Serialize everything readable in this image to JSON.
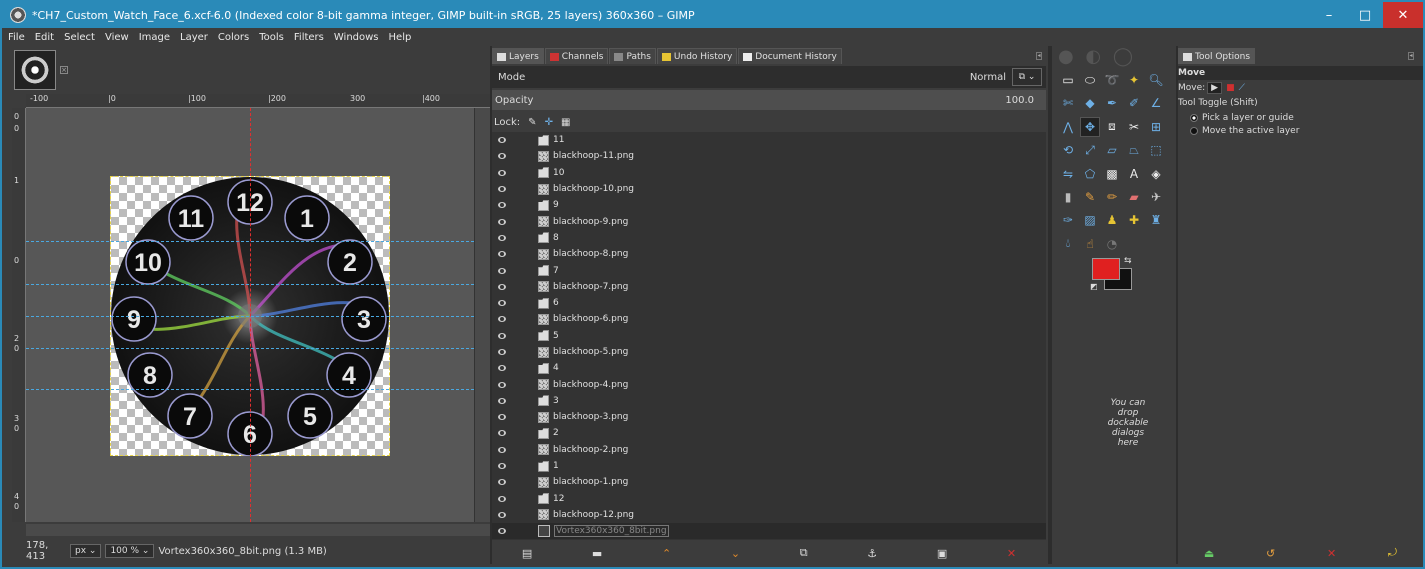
{
  "window": {
    "title": "*CH7_Custom_Watch_Face_6.xcf-6.0 (Indexed color 8-bit gamma integer, GIMP built-in sRGB, 25 layers) 360x360 – GIMP",
    "controls": {
      "minimize": "–",
      "maximize": "□",
      "close": "✕"
    }
  },
  "menu": [
    "File",
    "Edit",
    "Select",
    "View",
    "Image",
    "Layer",
    "Colors",
    "Tools",
    "Filters",
    "Windows",
    "Help"
  ],
  "rulers": {
    "top": [
      "-100",
      "|0",
      "|100",
      "|200",
      "300",
      "|400"
    ],
    "left": [
      "0",
      "0",
      "1",
      "0",
      "2",
      "0",
      "3",
      "0",
      "4",
      "0"
    ]
  },
  "canvas": {
    "dial_numbers": [
      "12",
      "1",
      "2",
      "3",
      "4",
      "5",
      "6",
      "7",
      "8",
      "9",
      "10",
      "11"
    ]
  },
  "status": {
    "coords": "178, 413",
    "unit": "px",
    "zoom": "100 %",
    "info": "Vortex360x360_8bit.png (1.3 MB)"
  },
  "dock_tabs": [
    "Layers",
    "Channels",
    "Paths",
    "Undo History",
    "Document History"
  ],
  "layers_panel": {
    "mode_label": "Mode",
    "mode_value": "Normal",
    "opacity_label": "Opacity",
    "opacity_value": "100.0",
    "lock_label": "Lock:",
    "layers": [
      {
        "name": "11",
        "type": "folder"
      },
      {
        "name": "blackhoop-11.png",
        "type": "png"
      },
      {
        "name": "10",
        "type": "folder"
      },
      {
        "name": "blackhoop-10.png",
        "type": "png"
      },
      {
        "name": "9",
        "type": "folder"
      },
      {
        "name": "blackhoop-9.png",
        "type": "png"
      },
      {
        "name": "8",
        "type": "folder"
      },
      {
        "name": "blackhoop-8.png",
        "type": "png"
      },
      {
        "name": "7",
        "type": "folder"
      },
      {
        "name": "blackhoop-7.png",
        "type": "png"
      },
      {
        "name": "6",
        "type": "folder"
      },
      {
        "name": "blackhoop-6.png",
        "type": "png"
      },
      {
        "name": "5",
        "type": "folder"
      },
      {
        "name": "blackhoop-5.png",
        "type": "png"
      },
      {
        "name": "4",
        "type": "folder"
      },
      {
        "name": "blackhoop-4.png",
        "type": "png"
      },
      {
        "name": "3",
        "type": "folder"
      },
      {
        "name": "blackhoop-3.png",
        "type": "png"
      },
      {
        "name": "2",
        "type": "folder"
      },
      {
        "name": "blackhoop-2.png",
        "type": "png"
      },
      {
        "name": "1",
        "type": "folder"
      },
      {
        "name": "blackhoop-1.png",
        "type": "png"
      },
      {
        "name": "12",
        "type": "folder"
      },
      {
        "name": "blackhoop-12.png",
        "type": "png"
      },
      {
        "name": "Vortex360x360_8bit.png",
        "type": "vortex"
      }
    ]
  },
  "toolbox": {
    "drop_hint": "You can drop dockable dialogs here",
    "fg_color": "#e02020",
    "bg_color": "#111111"
  },
  "tool_options": {
    "tab": "Tool Options",
    "title": "Move",
    "move_label": "Move:",
    "toggle_label": "Tool Toggle  (Shift)",
    "option_pick": "Pick a layer or guide",
    "option_active": "Move the active layer"
  }
}
